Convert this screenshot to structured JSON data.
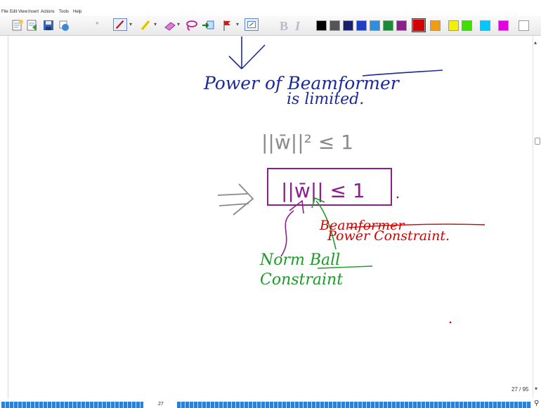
{
  "menu": [
    "File",
    "Edit",
    "View",
    "Insert",
    "Actions",
    "Tools",
    "Help"
  ],
  "toolbar": {
    "icons": [
      "new-page-icon",
      "open-icon",
      "save-icon",
      "print-icon",
      "pen-icon",
      "highlighter-icon",
      "eraser-icon",
      "lasso-icon",
      "insert-space-icon",
      "flag-icon",
      "text-box-icon"
    ],
    "bold_label": "B",
    "italic_label": "I",
    "colors": [
      "#000000",
      "#555555",
      "#1a1f6e",
      "#1e3fbf",
      "#2e8fe0",
      "#1d8a3a",
      "#8b1f8b",
      "#d40000",
      "#f39c12",
      "#f7ef00",
      "#3de000",
      "#00c8ff",
      "#e000e0",
      "#ffffff"
    ],
    "selected_color_index": 7
  },
  "ink": {
    "line1": "Power of Beamformer",
    "line2": "is limited.",
    "eq1": "||w̄||² ≤ 1",
    "eq2": "||w̄|| ≤ 1",
    "red_label_1": "Beamformer",
    "red_label_2": "Power Constraint.",
    "green_label_1": "Norm Ball",
    "green_label_2": "Constraint"
  },
  "page_indicator": "27 / 95",
  "bottom_page_number": "27"
}
